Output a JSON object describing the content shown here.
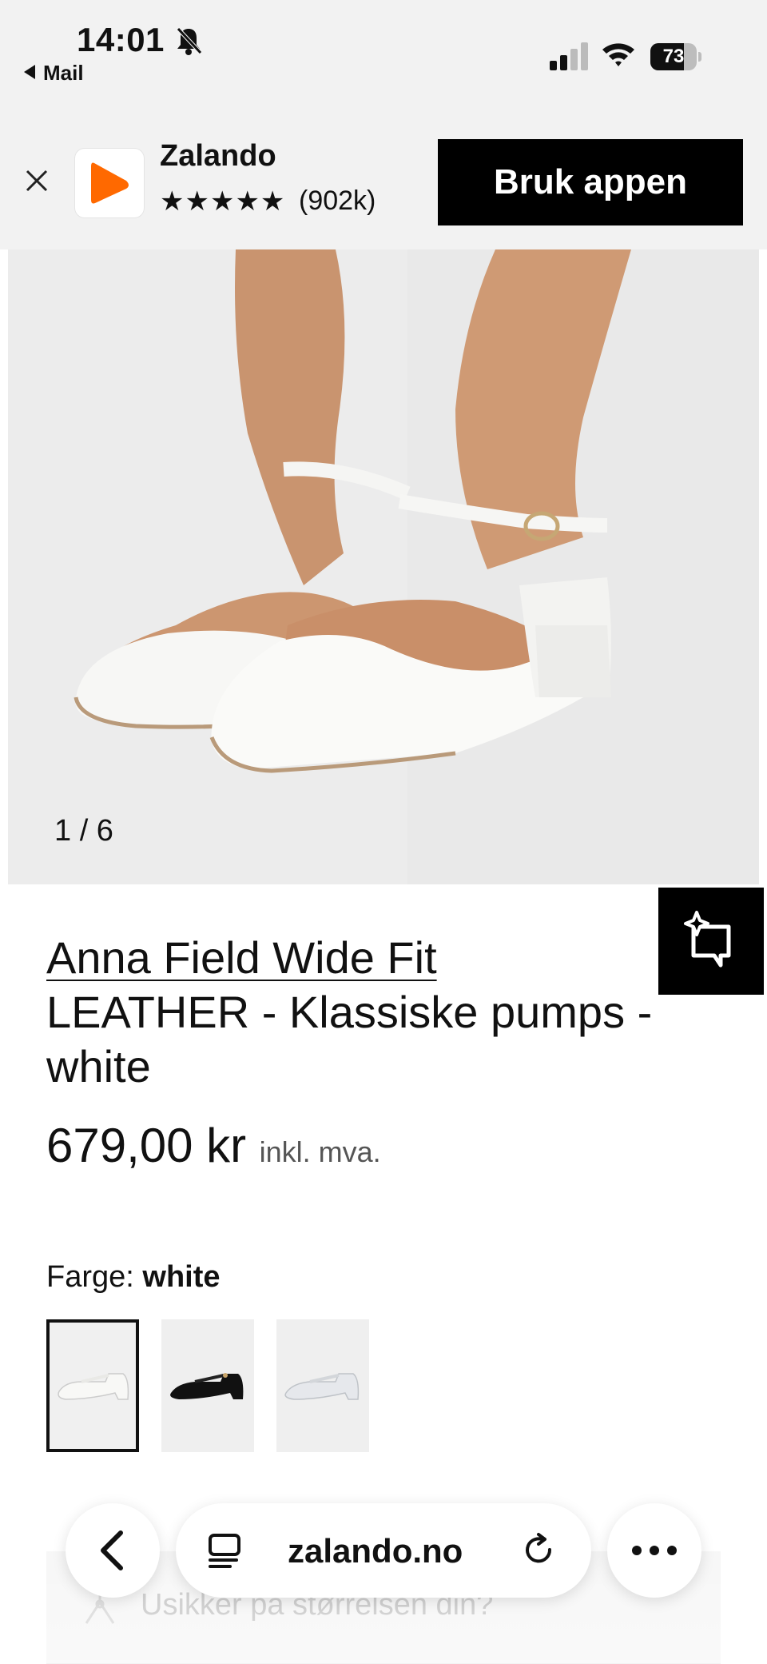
{
  "status": {
    "time": "14:01",
    "back_app": "Mail",
    "battery_level": 73,
    "battery_text": "73"
  },
  "banner": {
    "app_name": "Zalando",
    "stars": "★★★★★",
    "rating_count": "(902k)",
    "cta": "Bruk appen",
    "logo_color": "#ff6900"
  },
  "gallery": {
    "counter": "1 / 6"
  },
  "product": {
    "brand": "Anna Field Wide Fit",
    "name": "LEATHER - Klassiske pumps - white",
    "price": "679,00 kr",
    "vat": "inkl. mva.",
    "color_label": "Farge:",
    "color_value": "white",
    "swatches": [
      "white",
      "black",
      "silver"
    ]
  },
  "size_help": "Usikker på størrelsen din?",
  "browser": {
    "url": "zalando.no"
  },
  "colors": {
    "banner_bg": "#f2f2f2",
    "cta_bg": "#000000",
    "brand_orange": "#ff6900"
  },
  "icons": [
    "bell-slash-icon",
    "signal-icon",
    "wifi-icon",
    "close-icon",
    "zalando-logo",
    "ai-assistant-icon",
    "back-arrow-icon",
    "reader-icon",
    "reload-icon",
    "more-icon",
    "size-help-icon"
  ]
}
